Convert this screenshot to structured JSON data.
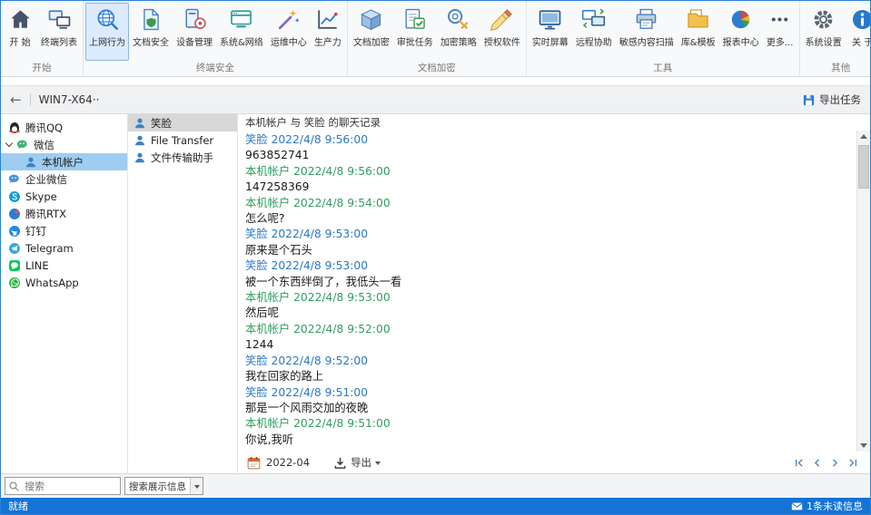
{
  "ribbon": {
    "groups": [
      {
        "label": "开始",
        "items": [
          {
            "label": "开 始",
            "icon": "home-icon"
          },
          {
            "label": "终端列表",
            "icon": "terminal-list-icon"
          }
        ]
      },
      {
        "label": "终端安全",
        "items": [
          {
            "label": "上网行为",
            "icon": "online-behavior-icon",
            "selected": true
          },
          {
            "label": "文档安全",
            "icon": "document-security-icon"
          },
          {
            "label": "设备管理",
            "icon": "device-management-icon"
          },
          {
            "label": "系统&网络",
            "icon": "system-network-icon"
          },
          {
            "label": "运维中心",
            "icon": "ops-center-icon"
          },
          {
            "label": "生产力",
            "icon": "productivity-icon"
          }
        ]
      },
      {
        "label": "文档加密",
        "items": [
          {
            "label": "文档加密",
            "icon": "document-encrypt-icon"
          },
          {
            "label": "审批任务",
            "icon": "approval-task-icon"
          },
          {
            "label": "加密策略",
            "icon": "encrypt-policy-icon"
          },
          {
            "label": "授权软件",
            "icon": "licensed-software-icon"
          }
        ]
      },
      {
        "label": "工具",
        "items": [
          {
            "label": "实时屏幕",
            "icon": "realtime-screen-icon"
          },
          {
            "label": "远程协助",
            "icon": "remote-assist-icon"
          },
          {
            "label": "敏感内容扫描",
            "icon": "content-scan-icon"
          },
          {
            "label": "库&模板",
            "icon": "library-template-icon"
          },
          {
            "label": "报表中心",
            "icon": "report-center-icon"
          },
          {
            "label": "更多...",
            "icon": "more-icon"
          }
        ]
      },
      {
        "label": "其他",
        "items": [
          {
            "label": "系统设置",
            "icon": "settings-icon"
          },
          {
            "label": "关 于",
            "icon": "about-icon"
          }
        ]
      }
    ]
  },
  "toolbar": {
    "back_glyph": "←",
    "terminal_name": "WIN7-X64··",
    "export_task_label": "导出任务",
    "export_task_icon": "export-task-icon"
  },
  "sidebar": {
    "items": [
      {
        "label": "腾讯QQ",
        "icon": "qq-icon"
      },
      {
        "label": "微信",
        "icon": "wechat-icon",
        "expanded": true,
        "children": [
          {
            "label": "本机帐户",
            "icon": "account-icon",
            "selected": true
          }
        ]
      },
      {
        "label": "企业微信",
        "icon": "wecom-icon"
      },
      {
        "label": "Skype",
        "icon": "skype-icon"
      },
      {
        "label": "腾讯RTX",
        "icon": "rtx-icon"
      },
      {
        "label": "钉钉",
        "icon": "dingtalk-icon"
      },
      {
        "label": "Telegram",
        "icon": "telegram-icon"
      },
      {
        "label": "LINE",
        "icon": "line-icon"
      },
      {
        "label": "WhatsApp",
        "icon": "whatsapp-icon"
      }
    ]
  },
  "contacts": {
    "items": [
      {
        "label": "笑脸",
        "icon": "contact-icon",
        "selected": true
      },
      {
        "label": "File Transfer",
        "icon": "contact-icon"
      },
      {
        "label": "文件传输助手",
        "icon": "contact-icon"
      }
    ]
  },
  "chat": {
    "header": "本机帐户 与 笑脸 的聊天记录",
    "messages": [
      {
        "sender": "笑脸",
        "time": "2022/4/8 9:56:00",
        "text": "963852741",
        "self": false
      },
      {
        "sender": "本机帐户",
        "time": "2022/4/8 9:56:00",
        "text": "147258369",
        "self": true
      },
      {
        "sender": "本机帐户",
        "time": "2022/4/8 9:54:00",
        "text": "怎么呢?",
        "self": true
      },
      {
        "sender": "笑脸",
        "time": "2022/4/8 9:53:00",
        "text": "原来是个石头",
        "self": false
      },
      {
        "sender": "笑脸",
        "time": "2022/4/8 9:53:00",
        "text": "被一个东西绊倒了，我低头一看",
        "self": false
      },
      {
        "sender": "本机帐户",
        "time": "2022/4/8 9:53:00",
        "text": "然后呢",
        "self": true
      },
      {
        "sender": "本机帐户",
        "time": "2022/4/8 9:52:00",
        "text": "1244",
        "self": true
      },
      {
        "sender": "笑脸",
        "time": "2022/4/8 9:52:00",
        "text": "我在回家的路上",
        "self": false
      },
      {
        "sender": "笑脸",
        "time": "2022/4/8 9:51:00",
        "text": "那是一个风雨交加的夜晚",
        "self": false
      },
      {
        "sender": "本机帐户",
        "time": "2022/4/8 9:51:00",
        "text": "你说,我听",
        "self": true
      }
    ],
    "footer": {
      "calendar_icon": "calendar-icon",
      "month": "2022-04",
      "download_icon": "download-icon",
      "export_label": "导出"
    }
  },
  "search": {
    "icon": "search-icon",
    "placeholder": "搜索",
    "display_combo": "搜索展示信息"
  },
  "statusbar": {
    "left": "就绪",
    "mail_icon": "mail-icon",
    "right": "1条未读信息"
  }
}
